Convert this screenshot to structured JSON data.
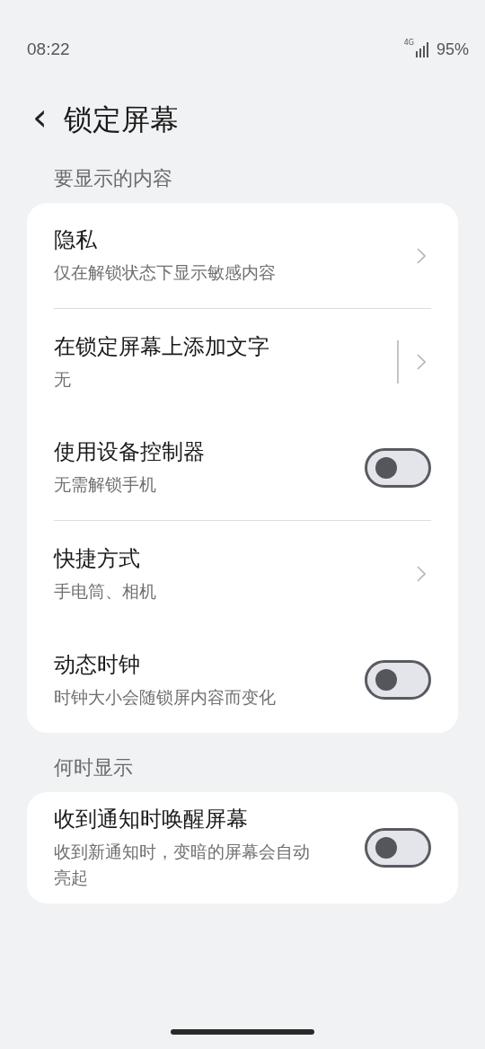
{
  "status_bar": {
    "time": "08:22",
    "network": "4G",
    "battery": "95%"
  },
  "header": {
    "back": "‹",
    "title": "锁定屏幕"
  },
  "sections": [
    {
      "title": "要显示的内容",
      "rows": [
        {
          "kind": "link",
          "title": "隐私",
          "subtitle": "仅在解锁状态下显示敏感内容",
          "divider": true
        },
        {
          "kind": "link_split",
          "title": "在锁定屏幕上添加文字",
          "subtitle": "无",
          "divider": false
        },
        {
          "kind": "toggle",
          "title": "使用设备控制器",
          "subtitle": "无需解锁手机",
          "on": false,
          "divider": true
        },
        {
          "kind": "link",
          "title": "快捷方式",
          "subtitle": "手电筒、相机",
          "divider": false
        },
        {
          "kind": "toggle",
          "title": "动态时钟",
          "subtitle": "时钟大小会随锁屏内容而变化",
          "on": false,
          "divider": false
        }
      ]
    },
    {
      "title": "何时显示",
      "rows": [
        {
          "kind": "toggle",
          "title": "收到通知时唤醒屏幕",
          "subtitle": "收到新通知时，变暗的屏幕会自动亮起",
          "on": false,
          "divider": false
        }
      ]
    }
  ]
}
